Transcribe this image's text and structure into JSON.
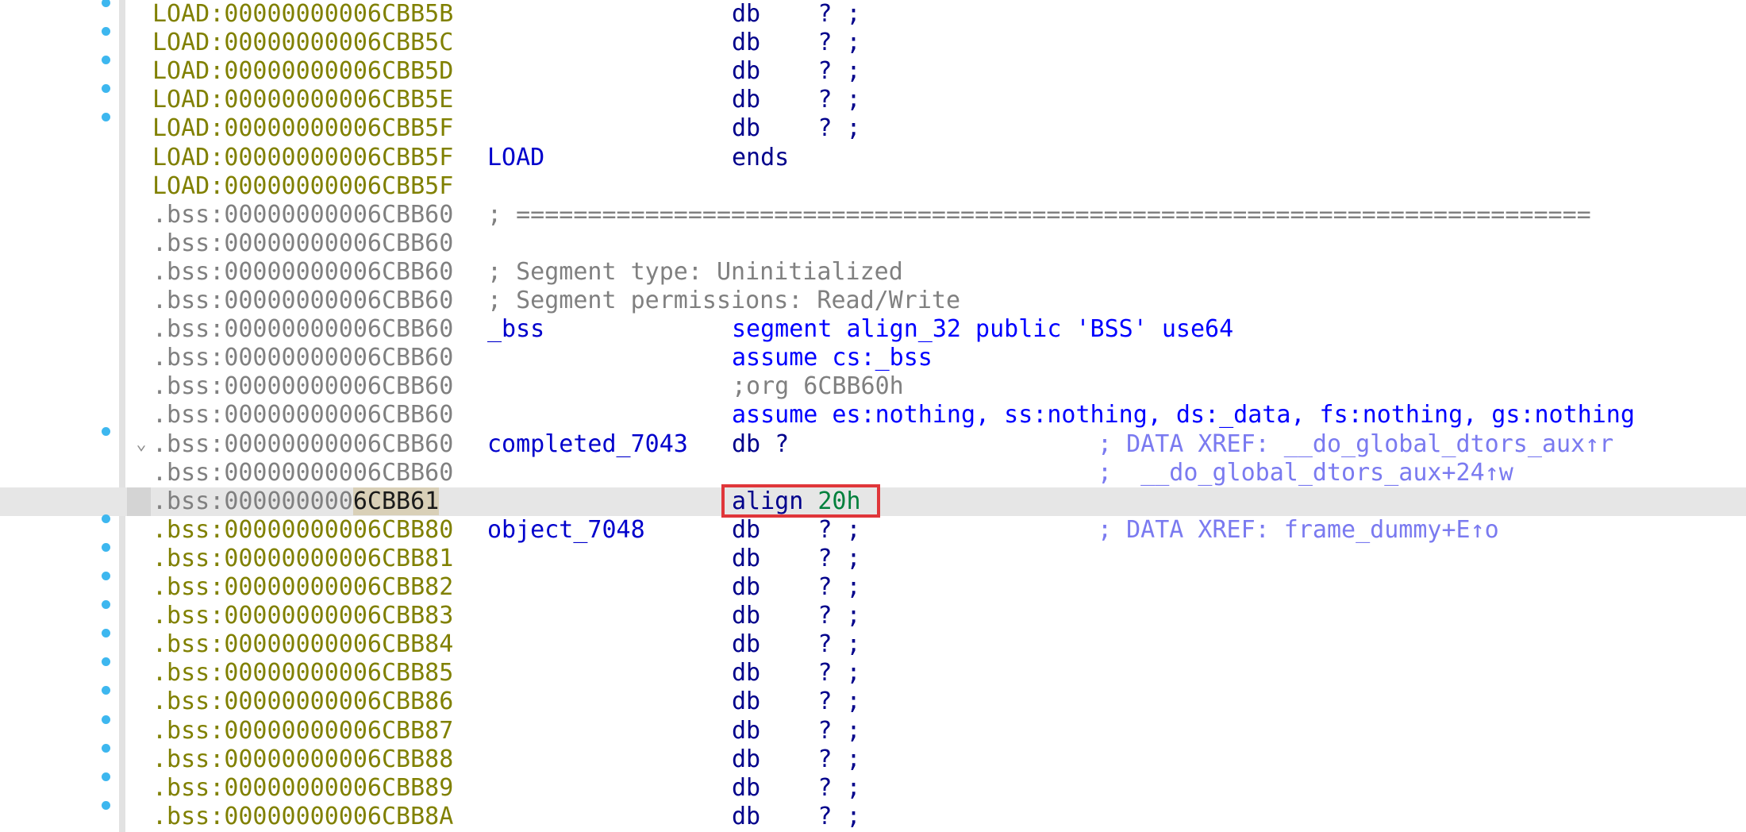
{
  "rows": [
    {
      "prefix": "LOAD:",
      "addr": "00000000006CBB5B",
      "seg": "load",
      "mnem": "db",
      "ops": "?",
      "suffix": ";"
    },
    {
      "prefix": "LOAD:",
      "addr": "00000000006CBB5C",
      "seg": "load",
      "mnem": "db",
      "ops": "?",
      "suffix": ";"
    },
    {
      "prefix": "LOAD:",
      "addr": "00000000006CBB5D",
      "seg": "load",
      "mnem": "db",
      "ops": "?",
      "suffix": ";"
    },
    {
      "prefix": "LOAD:",
      "addr": "00000000006CBB5E",
      "seg": "load",
      "mnem": "db",
      "ops": "?",
      "suffix": ";"
    },
    {
      "prefix": "LOAD:",
      "addr": "00000000006CBB5F",
      "seg": "load",
      "mnem": "db",
      "ops": "?",
      "suffix": ";"
    },
    {
      "prefix": "LOAD:",
      "addr": "00000000006CBB5F",
      "seg": "load",
      "label": "LOAD",
      "mnem": "ends"
    },
    {
      "prefix": "LOAD:",
      "addr": "00000000006CBB5F",
      "seg": "load"
    },
    {
      "prefix": ".bss:",
      "addr": "00000000006CBB60",
      "seg": "bss-gray",
      "comment": "; ==========================================================================="
    },
    {
      "prefix": ".bss:",
      "addr": "00000000006CBB60",
      "seg": "bss-gray"
    },
    {
      "prefix": ".bss:",
      "addr": "00000000006CBB60",
      "seg": "bss-gray",
      "comment": "; Segment type: Uninitialized"
    },
    {
      "prefix": ".bss:",
      "addr": "00000000006CBB60",
      "seg": "bss-gray",
      "comment": "; Segment permissions: Read/Write"
    },
    {
      "prefix": ".bss:",
      "addr": "00000000006CBB60",
      "seg": "bss-gray",
      "label": "_bss",
      "mnem": "segment align_32 public 'BSS' use64",
      "mnem_style": "blue"
    },
    {
      "prefix": ".bss:",
      "addr": "00000000006CBB60",
      "seg": "bss-gray",
      "mnem": "assume cs:_bss",
      "mnem_style": "blue"
    },
    {
      "prefix": ".bss:",
      "addr": "00000000006CBB60",
      "seg": "bss-gray",
      "mnem": ";org 6CBB60h",
      "mnem_style": "gray"
    },
    {
      "prefix": ".bss:",
      "addr": "00000000006CBB60",
      "seg": "bss-gray",
      "mnem": "assume es:nothing, ss:nothing, ds:_data, fs:nothing, gs:nothing",
      "mnem_style": "blue"
    },
    {
      "prefix": ".bss:",
      "addr": "00000000006CBB60",
      "seg": "bss-gray",
      "label": "completed_7043",
      "mnem": "db ?",
      "xref": "; DATA XREF: __do_global_dtors_aux↑r"
    },
    {
      "prefix": ".bss:",
      "addr": "00000000006CBB60",
      "seg": "bss-gray",
      "xref": ";  __do_global_dtors_aux+24↑w"
    },
    {
      "prefix": ".bss:",
      "addr_plain": "000000000",
      "addr_hl": "6CBB61",
      "seg": "bss-gray",
      "mnem": "align",
      "num": "20h",
      "selected": true
    },
    {
      "prefix": ".bss:",
      "addr": "00000000006CBB80",
      "seg": "bss-olive",
      "label": "object_7048",
      "mnem": "db",
      "ops": "?",
      "suffix": ";",
      "xref": "; DATA XREF: frame_dummy+E↑o"
    },
    {
      "prefix": ".bss:",
      "addr": "00000000006CBB81",
      "seg": "bss-olive",
      "mnem": "db",
      "ops": "?",
      "suffix": ";"
    },
    {
      "prefix": ".bss:",
      "addr": "00000000006CBB82",
      "seg": "bss-olive",
      "mnem": "db",
      "ops": "?",
      "suffix": ";"
    },
    {
      "prefix": ".bss:",
      "addr": "00000000006CBB83",
      "seg": "bss-olive",
      "mnem": "db",
      "ops": "?",
      "suffix": ";"
    },
    {
      "prefix": ".bss:",
      "addr": "00000000006CBB84",
      "seg": "bss-olive",
      "mnem": "db",
      "ops": "?",
      "suffix": ";"
    },
    {
      "prefix": ".bss:",
      "addr": "00000000006CBB85",
      "seg": "bss-olive",
      "mnem": "db",
      "ops": "?",
      "suffix": ";"
    },
    {
      "prefix": ".bss:",
      "addr": "00000000006CBB86",
      "seg": "bss-olive",
      "mnem": "db",
      "ops": "?",
      "suffix": ";"
    },
    {
      "prefix": ".bss:",
      "addr": "00000000006CBB87",
      "seg": "bss-olive",
      "mnem": "db",
      "ops": "?",
      "suffix": ";"
    },
    {
      "prefix": ".bss:",
      "addr": "00000000006CBB88",
      "seg": "bss-olive",
      "mnem": "db",
      "ops": "?",
      "suffix": ";"
    },
    {
      "prefix": ".bss:",
      "addr": "00000000006CBB89",
      "seg": "bss-olive",
      "mnem": "db",
      "ops": "?",
      "suffix": ";"
    },
    {
      "prefix": ".bss:",
      "addr": "00000000006CBB8A",
      "seg": "bss-olive",
      "mnem": "db",
      "ops": "?",
      "suffix": ";"
    }
  ],
  "colors": {
    "load_address": "#808000",
    "bss_address": "#808080",
    "label": "#0000cc",
    "mnemonic": "#00008b",
    "comment": "#808080",
    "xref": "#7a7af0",
    "number": "#00803c",
    "selection_box": "#e0363a",
    "breakpoint_dot": "#3db7ef"
  },
  "icons": {
    "row_dot": "breakpoint-dot-icon",
    "collapse": "chevron-down-icon"
  }
}
